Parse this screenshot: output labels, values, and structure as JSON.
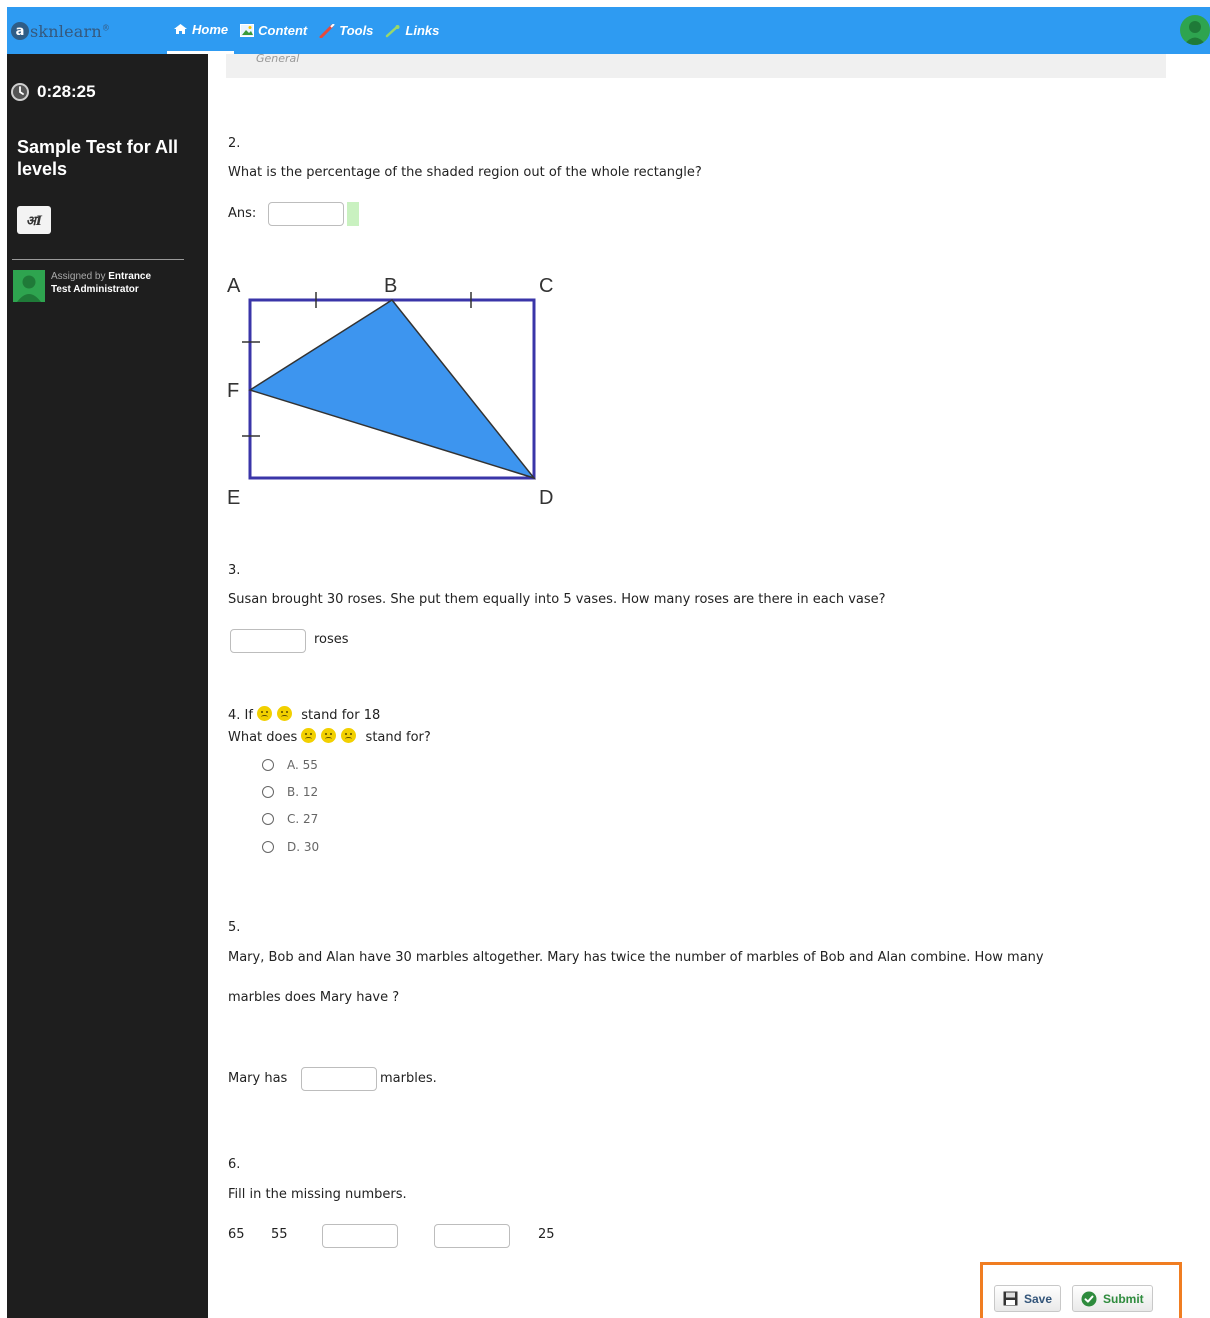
{
  "topbar": {
    "logo_letter": "a",
    "logo_text": "sknlearn",
    "logo_tm": "®",
    "nav": [
      {
        "label": "Home",
        "icon": "home-icon",
        "active": true
      },
      {
        "label": "Content",
        "icon": "content-icon",
        "active": false
      },
      {
        "label": "Tools",
        "icon": "tools-icon",
        "active": false
      },
      {
        "label": "Links",
        "icon": "links-icon",
        "active": false
      }
    ],
    "color": "#2e9bf2"
  },
  "sidebar": {
    "timer": "0:28:25",
    "test_title": "Sample Test for All levels",
    "ai_button": "अI",
    "assigned_prefix": "Assigned by",
    "assigned_name": "Entrance Test Administrator"
  },
  "content": {
    "strip_label": "General",
    "q2": {
      "number": "2.",
      "text": "What is the percentage of the shaded region out of the whole rectangle?",
      "ans_label": "Ans:",
      "ans_value": "",
      "diagram_labels": {
        "A": "A",
        "B": "B",
        "C": "C",
        "D": "D",
        "E": "E",
        "F": "F"
      },
      "rect_color": "#3a35a8",
      "fill_color": "#3d95ef"
    },
    "q3": {
      "number": "3.",
      "text": "Susan brought 30 roses. She put them equally into 5 vases. How many roses are there in each vase?",
      "unit": "roses",
      "value": ""
    },
    "q4": {
      "line1_prefix": "4. If",
      "line1_suffix": "stand for 18",
      "line2_prefix": "What does",
      "line2_suffix": "stand for?",
      "emoji_icon": "sad-face-icon",
      "options": [
        {
          "letter": "A.",
          "value": "55"
        },
        {
          "letter": "B.",
          "value": "12"
        },
        {
          "letter": "C.",
          "value": "27"
        },
        {
          "letter": "D.",
          "value": "30"
        }
      ]
    },
    "q5": {
      "number": "5.",
      "text_line1": "Mary, Bob and Alan have 30 marbles altogether. Mary has twice the number of marbles of Bob and Alan combine. How many",
      "text_line2": "marbles does Mary have ?",
      "prefix": "Mary has",
      "suffix": "marbles.",
      "value": ""
    },
    "q6": {
      "number": "6.",
      "text": "Fill in the missing numbers.",
      "values": [
        "65",
        "55",
        "",
        "",
        "25"
      ]
    }
  },
  "actions": {
    "save_label": "Save",
    "submit_label": "Submit",
    "highlight_color": "#f07d21"
  }
}
